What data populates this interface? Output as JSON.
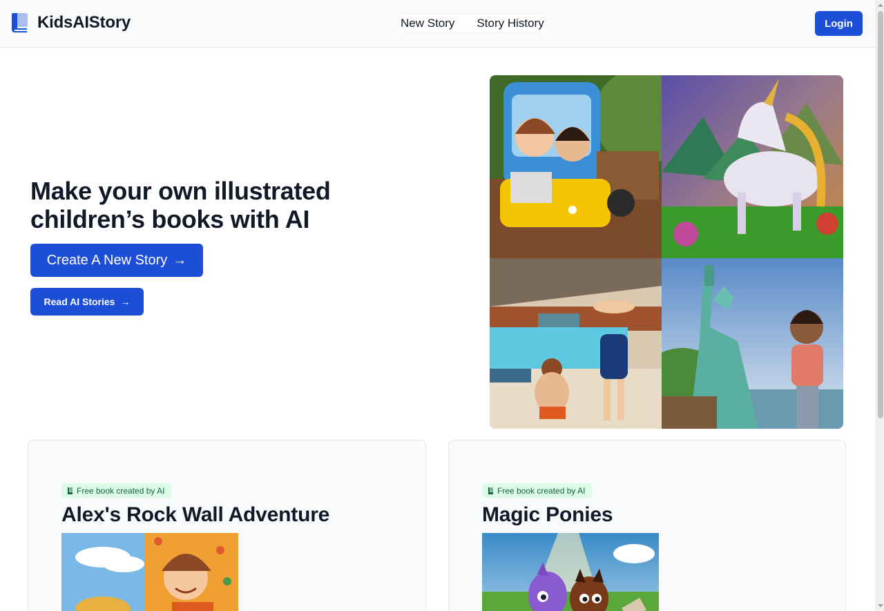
{
  "header": {
    "brand": "KidsAIStory",
    "nav": [
      "New Story",
      "Story History"
    ],
    "login": "Login",
    "brand_color": "#1d4ed8"
  },
  "hero": {
    "title": "Make your own illustrated children’s books with AI",
    "create_button": "Create A New Story",
    "read_button": "Read AI Stories",
    "arrow_icon": "→"
  },
  "collage": {
    "images": [
      "kids-in-toy-truck",
      "unicorn-in-forest",
      "kids-by-pool",
      "boy-at-statue-of-liberty"
    ]
  },
  "stories": [
    {
      "badge": "Free book created by AI",
      "title": "Alex's Rock Wall Adventure",
      "cover": "boy-climbing-rock-wall"
    },
    {
      "badge": "Free book created by AI",
      "title": "Magic Ponies",
      "cover": "cartoon-ponies"
    }
  ]
}
